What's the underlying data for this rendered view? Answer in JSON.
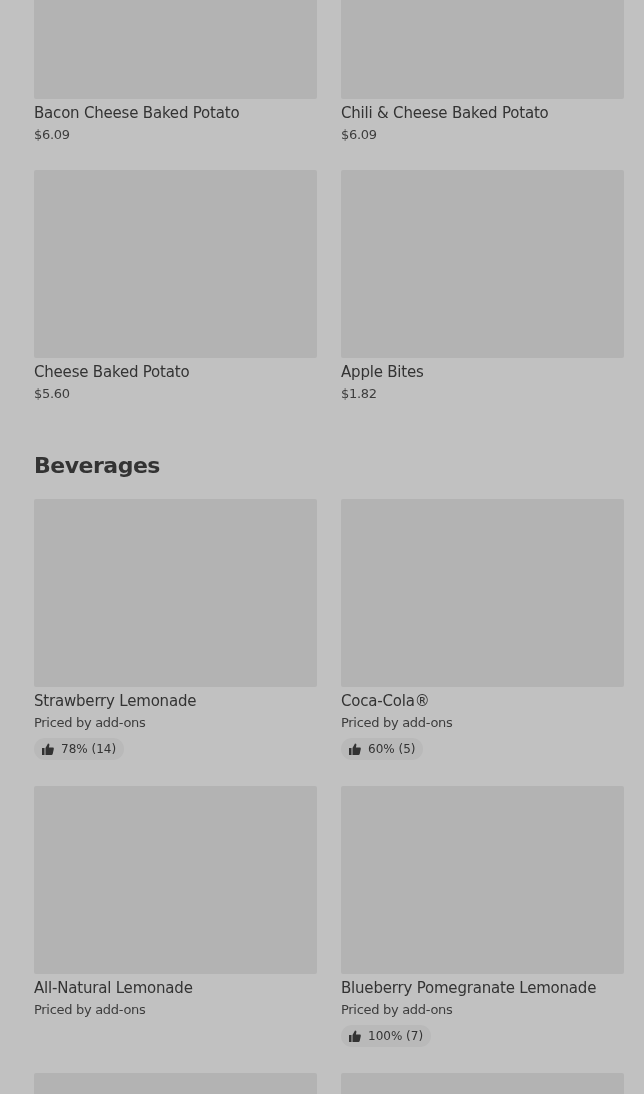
{
  "sections": [
    {
      "items": [
        {
          "kind": "item",
          "name": "Bacon Cheese Baked Potato",
          "price": "$6.09"
        },
        {
          "kind": "item",
          "name": "Chili & Cheese Baked Potato",
          "price": "$6.09"
        },
        {
          "kind": "item",
          "name": "Cheese Baked Potato",
          "price": "$5.60"
        },
        {
          "kind": "item",
          "name": "Apple Bites",
          "price": "$1.82"
        }
      ]
    },
    {
      "title": "Beverages",
      "items": [
        {
          "kind": "item",
          "name": "Strawberry Lemonade",
          "price": "Priced by add-ons",
          "rating": "78% (14)"
        },
        {
          "kind": "item",
          "name": "Coca-Cola®",
          "price": "Priced by add-ons",
          "rating": "60% (5)"
        },
        {
          "kind": "item",
          "name": "All-Natural Lemonade",
          "price": "Priced by add-ons"
        },
        {
          "kind": "item",
          "name": "Blueberry Pomegranate Lemonade",
          "price": "Priced by add-ons",
          "rating": "100% (7)"
        },
        {
          "kind": "image_only"
        },
        {
          "kind": "image_only"
        }
      ]
    }
  ]
}
